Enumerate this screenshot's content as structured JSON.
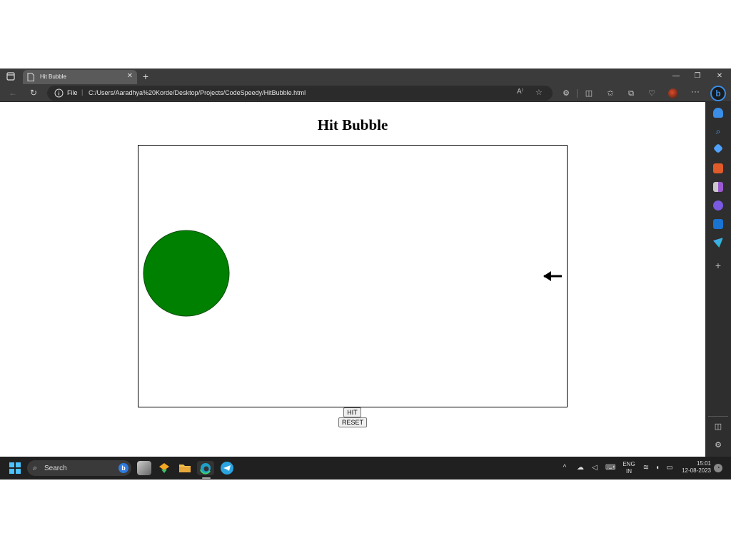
{
  "browser": {
    "tab_title": "Hit Bubble",
    "url_scheme": "File",
    "url_path": "C:/Users/Aaradhya%20Korde/Desktop/Projects/CodeSpeedy/HitBubble.html",
    "read_aloud": "A⁾"
  },
  "page": {
    "title": "Hit Bubble",
    "hit_label": "HIT",
    "reset_label": "RESET"
  },
  "game": {
    "bubble_color": "#008000",
    "arrow_color": "#000000",
    "border_color": "#000000"
  },
  "taskbar": {
    "search_placeholder": "Search",
    "lang_top": "ENG",
    "lang_bottom": "IN",
    "time": "15:01",
    "date": "12-08-2023"
  }
}
